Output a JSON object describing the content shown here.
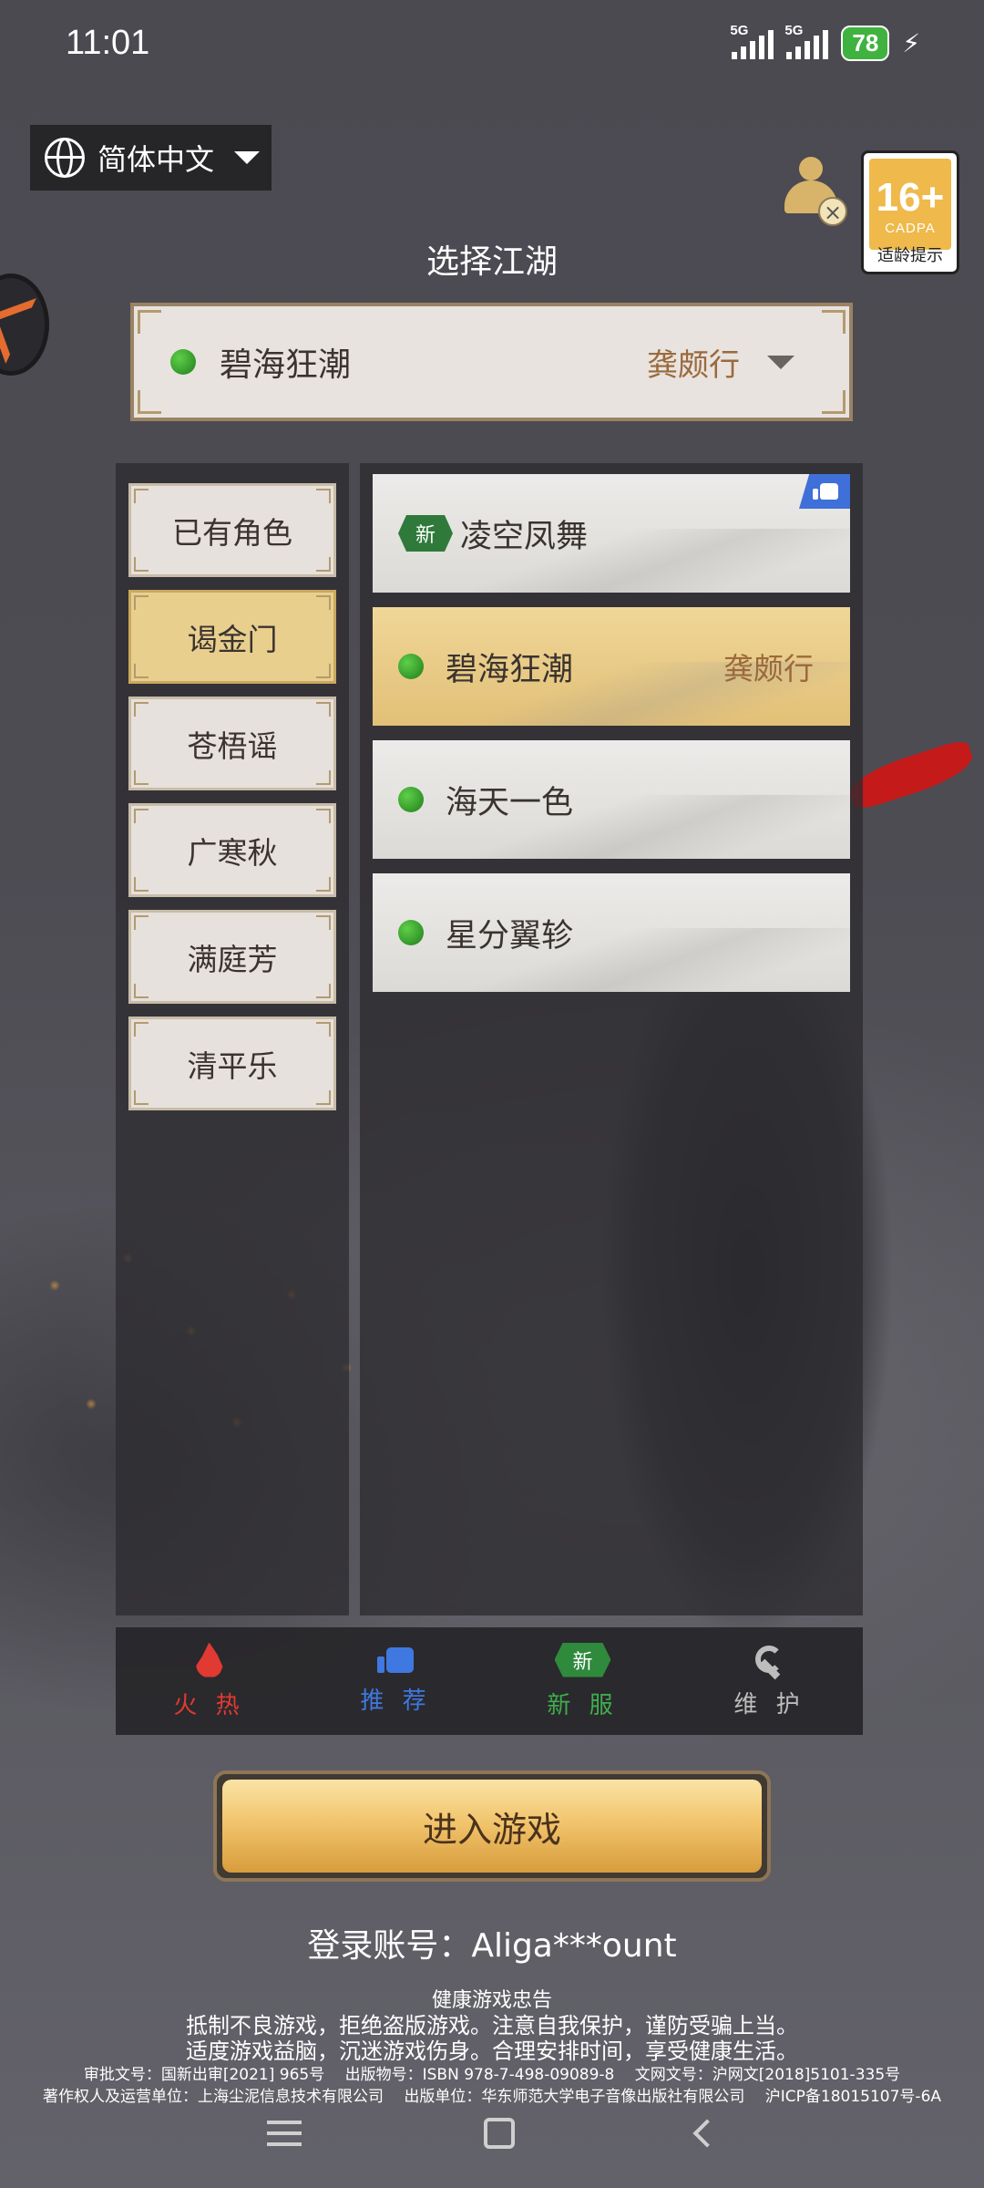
{
  "status_bar": {
    "time": "11:01",
    "signal1": "5G",
    "signal2": "5G",
    "battery": "78"
  },
  "language": {
    "label": "简体中文"
  },
  "age_rating": {
    "number": "16+",
    "org": "CADPA",
    "tip": "适龄提示"
  },
  "title": "选择江湖",
  "selected_server": {
    "name": "碧海狂潮",
    "tag": "龚颇行"
  },
  "categories": [
    {
      "label": "已有角色",
      "active": false
    },
    {
      "label": "谒金门",
      "active": true
    },
    {
      "label": "苍梧谣",
      "active": false
    },
    {
      "label": "广寒秋",
      "active": false
    },
    {
      "label": "满庭芳",
      "active": false
    },
    {
      "label": "清平乐",
      "active": false
    }
  ],
  "servers": [
    {
      "name": "凌空凤舞",
      "badge": "新",
      "recommended": true,
      "tag": ""
    },
    {
      "name": "碧海狂潮",
      "tag": "龚颇行",
      "active": true
    },
    {
      "name": "海天一色",
      "tag": ""
    },
    {
      "name": "星分翼轸",
      "tag": ""
    }
  ],
  "tabs": [
    {
      "label": "火 热",
      "color": "#e03a32",
      "icon": "fire-icon"
    },
    {
      "label": "推 荐",
      "color": "#3f78e0",
      "icon": "thumbs-up-icon"
    },
    {
      "label": "新 服",
      "color": "#3fae4c",
      "icon": "new-server-icon",
      "badge": "新"
    },
    {
      "label": "维 护",
      "color": "#bdbdbd",
      "icon": "wrench-icon"
    }
  ],
  "enter_button": "进入游戏",
  "account": "登录账号：Aliga***ount",
  "notice": {
    "title": "健康游戏忠告",
    "line1": "抵制不良游戏，拒绝盗版游戏。注意自我保护，谨防受骗上当。",
    "line2": "适度游戏益脑，沉迷游戏伤身。合理安排时间，享受健康生活。",
    "line3": "审批文号：国新出审[2021] 965号　 出版物号：ISBN 978-7-498-09089-8　 文网文号：沪网文[2018]5101-335号",
    "line4": "著作权人及运营单位：上海尘泥信息技术有限公司　 出版单位：华东师范大学电子音像出版社有限公司　 沪ICP备18015107号-6A"
  }
}
